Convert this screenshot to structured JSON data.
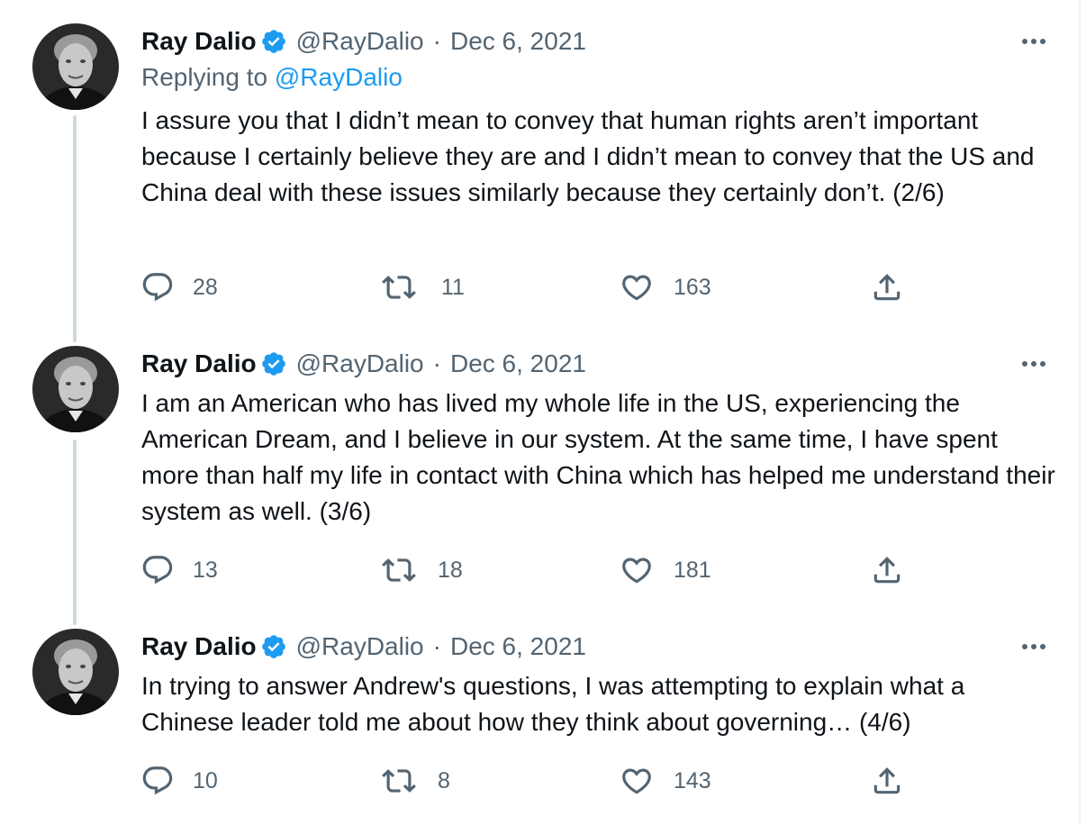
{
  "tweets": [
    {
      "name": "Ray Dalio",
      "handle": "@RayDalio",
      "separator": "·",
      "date": "Dec 6, 2021",
      "replying_prefix": "Replying to",
      "replying_handle": "@RayDalio",
      "text": "I assure you that I didn’t mean to convey that human rights aren’t important because I certainly believe they are and I didn’t mean to convey that the US and China deal with these issues similarly because they certainly don’t. (2/6)",
      "replies": "28",
      "retweets": "11",
      "likes": "163"
    },
    {
      "name": "Ray Dalio",
      "handle": "@RayDalio",
      "separator": "·",
      "date": "Dec 6, 2021",
      "text": "I am an American who has lived my whole life in the US, experiencing the American Dream, and I believe in our system. At the same time, I have spent more than half my life in contact with China which has helped me understand their system as well. (3/6)",
      "replies": "13",
      "retweets": "18",
      "likes": "181"
    },
    {
      "name": "Ray Dalio",
      "handle": "@RayDalio",
      "separator": "·",
      "date": "Dec 6, 2021",
      "text": "In trying to answer Andrew's questions, I was attempting to explain what a Chinese leader told me about how they think about governing… (4/6)",
      "replies": "10",
      "retweets": "8",
      "likes": "143"
    }
  ],
  "icons": {
    "verified": "verified-badge-icon",
    "more": "more-options-icon",
    "reply": "reply-icon",
    "retweet": "retweet-icon",
    "like": "like-icon",
    "share": "share-icon"
  },
  "colors": {
    "text": "#0f1419",
    "secondary": "#536471",
    "link": "#1d9bf0",
    "thread_line": "#cfd9de"
  }
}
